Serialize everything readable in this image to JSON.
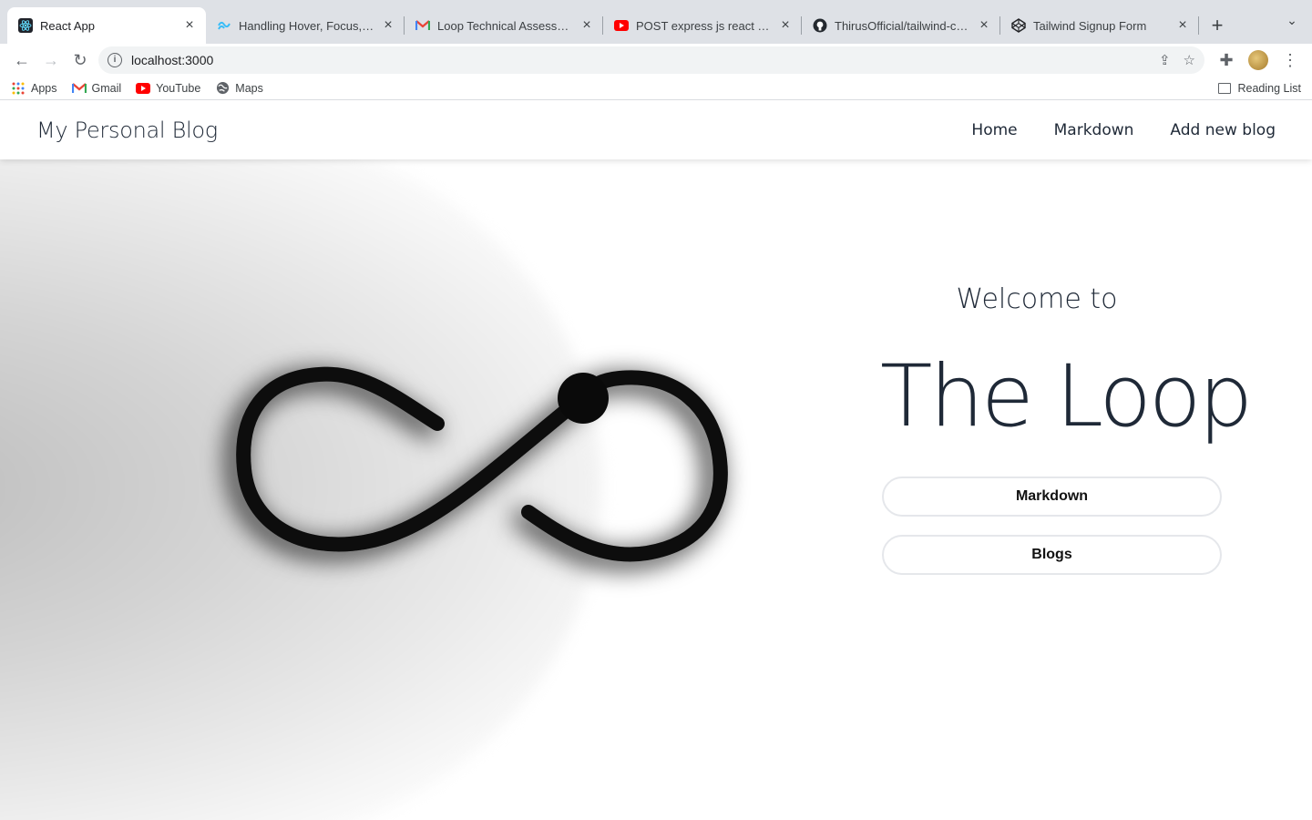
{
  "browser": {
    "tabs": [
      {
        "title": "React App",
        "icon": "react-icon",
        "active": true
      },
      {
        "title": "Handling Hover, Focus, and Other States",
        "icon": "tailwind-icon"
      },
      {
        "title": "Loop Technical Assessment",
        "icon": "gmail-icon"
      },
      {
        "title": "POST express js react - YouTube",
        "icon": "youtube-icon"
      },
      {
        "title": "ThirusOfficial/tailwind-css-signup",
        "icon": "github-icon"
      },
      {
        "title": "Tailwind Signup Form",
        "icon": "codepen-icon"
      }
    ],
    "url": "localhost:3000",
    "bookmarks": [
      {
        "label": "Apps",
        "icon": "apps-grid-icon"
      },
      {
        "label": "Gmail",
        "icon": "gmail-icon"
      },
      {
        "label": "YouTube",
        "icon": "youtube-icon"
      },
      {
        "label": "Maps",
        "icon": "maps-icon"
      }
    ],
    "reading_list": "Reading List"
  },
  "site": {
    "brand": "My Personal Blog",
    "nav": [
      "Home",
      "Markdown",
      "Add new blog"
    ],
    "hero": {
      "welcome": "Welcome to",
      "title": "The Loop",
      "buttons": [
        "Markdown",
        "Blogs"
      ]
    }
  }
}
